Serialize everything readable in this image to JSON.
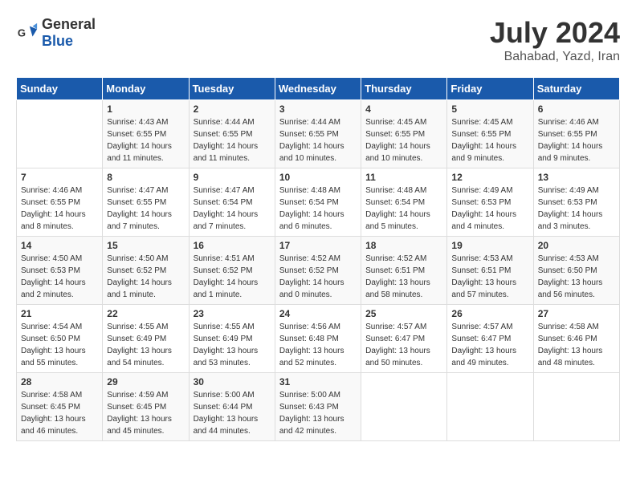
{
  "logo": {
    "general": "General",
    "blue": "Blue"
  },
  "title": {
    "month": "July 2024",
    "location": "Bahabad, Yazd, Iran"
  },
  "days_of_week": [
    "Sunday",
    "Monday",
    "Tuesday",
    "Wednesday",
    "Thursday",
    "Friday",
    "Saturday"
  ],
  "weeks": [
    [
      {
        "day": "",
        "sunrise": "",
        "sunset": "",
        "daylight": ""
      },
      {
        "day": "1",
        "sunrise": "4:43 AM",
        "sunset": "6:55 PM",
        "daylight": "14 hours and 11 minutes."
      },
      {
        "day": "2",
        "sunrise": "4:44 AM",
        "sunset": "6:55 PM",
        "daylight": "14 hours and 11 minutes."
      },
      {
        "day": "3",
        "sunrise": "4:44 AM",
        "sunset": "6:55 PM",
        "daylight": "14 hours and 10 minutes."
      },
      {
        "day": "4",
        "sunrise": "4:45 AM",
        "sunset": "6:55 PM",
        "daylight": "14 hours and 10 minutes."
      },
      {
        "day": "5",
        "sunrise": "4:45 AM",
        "sunset": "6:55 PM",
        "daylight": "14 hours and 9 minutes."
      },
      {
        "day": "6",
        "sunrise": "4:46 AM",
        "sunset": "6:55 PM",
        "daylight": "14 hours and 9 minutes."
      }
    ],
    [
      {
        "day": "7",
        "sunrise": "4:46 AM",
        "sunset": "6:55 PM",
        "daylight": "14 hours and 8 minutes."
      },
      {
        "day": "8",
        "sunrise": "4:47 AM",
        "sunset": "6:55 PM",
        "daylight": "14 hours and 7 minutes."
      },
      {
        "day": "9",
        "sunrise": "4:47 AM",
        "sunset": "6:54 PM",
        "daylight": "14 hours and 7 minutes."
      },
      {
        "day": "10",
        "sunrise": "4:48 AM",
        "sunset": "6:54 PM",
        "daylight": "14 hours and 6 minutes."
      },
      {
        "day": "11",
        "sunrise": "4:48 AM",
        "sunset": "6:54 PM",
        "daylight": "14 hours and 5 minutes."
      },
      {
        "day": "12",
        "sunrise": "4:49 AM",
        "sunset": "6:53 PM",
        "daylight": "14 hours and 4 minutes."
      },
      {
        "day": "13",
        "sunrise": "4:49 AM",
        "sunset": "6:53 PM",
        "daylight": "14 hours and 3 minutes."
      }
    ],
    [
      {
        "day": "14",
        "sunrise": "4:50 AM",
        "sunset": "6:53 PM",
        "daylight": "14 hours and 2 minutes."
      },
      {
        "day": "15",
        "sunrise": "4:50 AM",
        "sunset": "6:52 PM",
        "daylight": "14 hours and 1 minute."
      },
      {
        "day": "16",
        "sunrise": "4:51 AM",
        "sunset": "6:52 PM",
        "daylight": "14 hours and 1 minute."
      },
      {
        "day": "17",
        "sunrise": "4:52 AM",
        "sunset": "6:52 PM",
        "daylight": "14 hours and 0 minutes."
      },
      {
        "day": "18",
        "sunrise": "4:52 AM",
        "sunset": "6:51 PM",
        "daylight": "13 hours and 58 minutes."
      },
      {
        "day": "19",
        "sunrise": "4:53 AM",
        "sunset": "6:51 PM",
        "daylight": "13 hours and 57 minutes."
      },
      {
        "day": "20",
        "sunrise": "4:53 AM",
        "sunset": "6:50 PM",
        "daylight": "13 hours and 56 minutes."
      }
    ],
    [
      {
        "day": "21",
        "sunrise": "4:54 AM",
        "sunset": "6:50 PM",
        "daylight": "13 hours and 55 minutes."
      },
      {
        "day": "22",
        "sunrise": "4:55 AM",
        "sunset": "6:49 PM",
        "daylight": "13 hours and 54 minutes."
      },
      {
        "day": "23",
        "sunrise": "4:55 AM",
        "sunset": "6:49 PM",
        "daylight": "13 hours and 53 minutes."
      },
      {
        "day": "24",
        "sunrise": "4:56 AM",
        "sunset": "6:48 PM",
        "daylight": "13 hours and 52 minutes."
      },
      {
        "day": "25",
        "sunrise": "4:57 AM",
        "sunset": "6:47 PM",
        "daylight": "13 hours and 50 minutes."
      },
      {
        "day": "26",
        "sunrise": "4:57 AM",
        "sunset": "6:47 PM",
        "daylight": "13 hours and 49 minutes."
      },
      {
        "day": "27",
        "sunrise": "4:58 AM",
        "sunset": "6:46 PM",
        "daylight": "13 hours and 48 minutes."
      }
    ],
    [
      {
        "day": "28",
        "sunrise": "4:58 AM",
        "sunset": "6:45 PM",
        "daylight": "13 hours and 46 minutes."
      },
      {
        "day": "29",
        "sunrise": "4:59 AM",
        "sunset": "6:45 PM",
        "daylight": "13 hours and 45 minutes."
      },
      {
        "day": "30",
        "sunrise": "5:00 AM",
        "sunset": "6:44 PM",
        "daylight": "13 hours and 44 minutes."
      },
      {
        "day": "31",
        "sunrise": "5:00 AM",
        "sunset": "6:43 PM",
        "daylight": "13 hours and 42 minutes."
      },
      {
        "day": "",
        "sunrise": "",
        "sunset": "",
        "daylight": ""
      },
      {
        "day": "",
        "sunrise": "",
        "sunset": "",
        "daylight": ""
      },
      {
        "day": "",
        "sunrise": "",
        "sunset": "",
        "daylight": ""
      }
    ]
  ]
}
